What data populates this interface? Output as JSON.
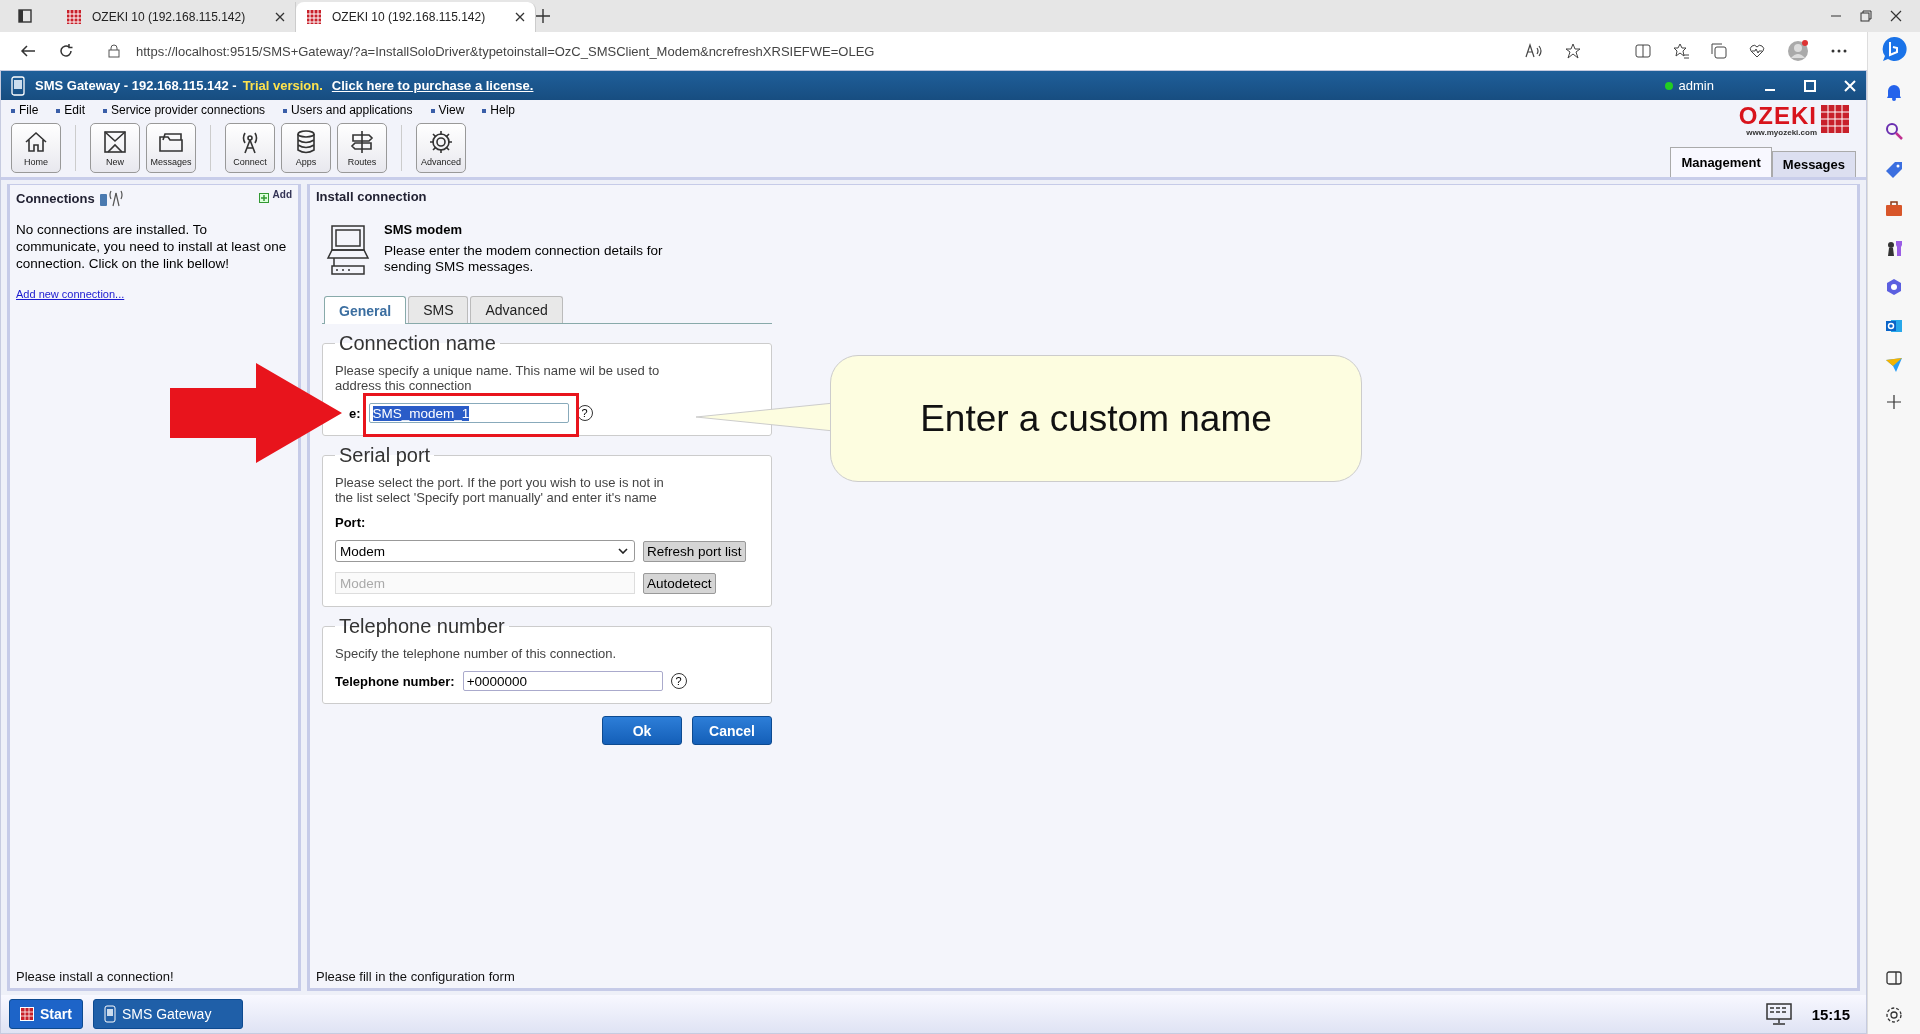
{
  "browser": {
    "tabs": [
      {
        "title": "OZEKI 10 (192.168.115.142)",
        "selected": false
      },
      {
        "title": "OZEKI 10 (192.168.115.142)",
        "selected": true
      }
    ],
    "url": "https://localhost:9515/SMS+Gateway/?a=InstallSoloDriver&typetoinstall=OzC_SMSClient_Modem&ncrefreshXRSIEFWE=OLEG"
  },
  "app": {
    "title": "SMS Gateway - 192.168.115.142 -",
    "trial": "Trial version.",
    "purchase_link": "Click here to purchase a license.",
    "user": "admin"
  },
  "menu": [
    "File",
    "Edit",
    "Service provider connections",
    "Users and applications",
    "View",
    "Help"
  ],
  "toolbar": [
    [
      {
        "label": "Home",
        "kind": "home"
      }
    ],
    [
      {
        "label": "New",
        "kind": "new"
      },
      {
        "label": "Messages",
        "kind": "folder"
      }
    ],
    [
      {
        "label": "Connect",
        "kind": "antenna"
      },
      {
        "label": "Apps",
        "kind": "database"
      },
      {
        "label": "Routes",
        "kind": "routes"
      }
    ],
    [
      {
        "label": "Advanced",
        "kind": "gear"
      }
    ]
  ],
  "logo": {
    "name": "OZEKI",
    "url": "www.myozeki.com"
  },
  "view_tabs": [
    {
      "label": "Management",
      "selected": true
    },
    {
      "label": "Messages",
      "selected": false
    }
  ],
  "sidebar": {
    "title": "Connections",
    "add": "Add",
    "message": "No connections are installed. To communicate, you need to install at least one connection. Click on the link bellow!",
    "link": "Add new connection...",
    "status": "Please install a connection!"
  },
  "main": {
    "heading": "Install connection",
    "item_title": "SMS modem",
    "item_description": "Please enter the modem connection details for sending SMS messages.",
    "tabs": [
      {
        "label": "General",
        "selected": true
      },
      {
        "label": "SMS",
        "selected": false
      },
      {
        "label": "Advanced",
        "selected": false
      }
    ],
    "connection_name": {
      "legend": "Connection name",
      "hint": "Please specify a unique name. This name wil be used to address this connection",
      "label": "e:",
      "value": "SMS_modem_1",
      "help": "?"
    },
    "serial_port": {
      "legend": "Serial port",
      "hint": "Please select the port. If the port you wish to use is not in the list select 'Specify port manually' and enter it's name",
      "port_label": "Port:",
      "port_value": "Modem",
      "refresh": "Refresh port list",
      "manual_placeholder": "Modem",
      "autodetect": "Autodetect"
    },
    "telephone": {
      "legend": "Telephone number",
      "hint": "Specify the telephone number of this connection.",
      "label": "Telephone number:",
      "value": "+0000000",
      "help": "?"
    },
    "buttons": [
      "Ok",
      "Cancel"
    ],
    "status": "Please fill in the configuration form"
  },
  "annotation": {
    "text": "Enter a custom name"
  },
  "taskbar": {
    "start": "Start",
    "app": "SMS Gateway",
    "clock": "15:15"
  }
}
